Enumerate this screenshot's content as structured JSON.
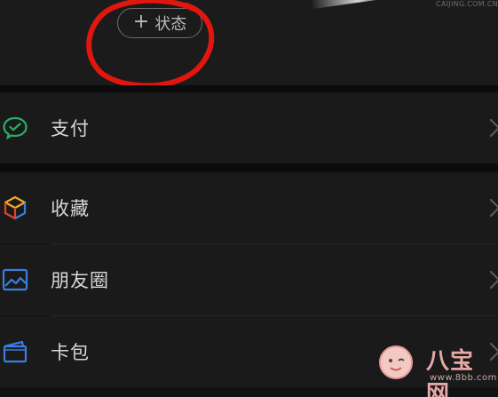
{
  "header": {
    "status_button_plus": "+",
    "status_button_label": "状态",
    "watermark_top": "CAIJING.COM.CN"
  },
  "menu": {
    "items": [
      {
        "label": "支付",
        "icon": "wechat-pay-icon",
        "icon_color": "#2aae67"
      },
      {
        "label": "收藏",
        "icon": "favorites-cube-icon",
        "icon_color": "#f0a92e"
      },
      {
        "label": "朋友圈",
        "icon": "moments-image-icon",
        "icon_color": "#3b7de0"
      },
      {
        "label": "卡包",
        "icon": "card-wallet-icon",
        "icon_color": "#3b7de0"
      }
    ]
  },
  "watermark": {
    "brand": "八宝网",
    "site": "www.8bb.com"
  },
  "colors": {
    "background": "#121212",
    "row": "#1a1a1a",
    "annotation_circle": "#e0160f",
    "text": "#d7d7d7"
  }
}
